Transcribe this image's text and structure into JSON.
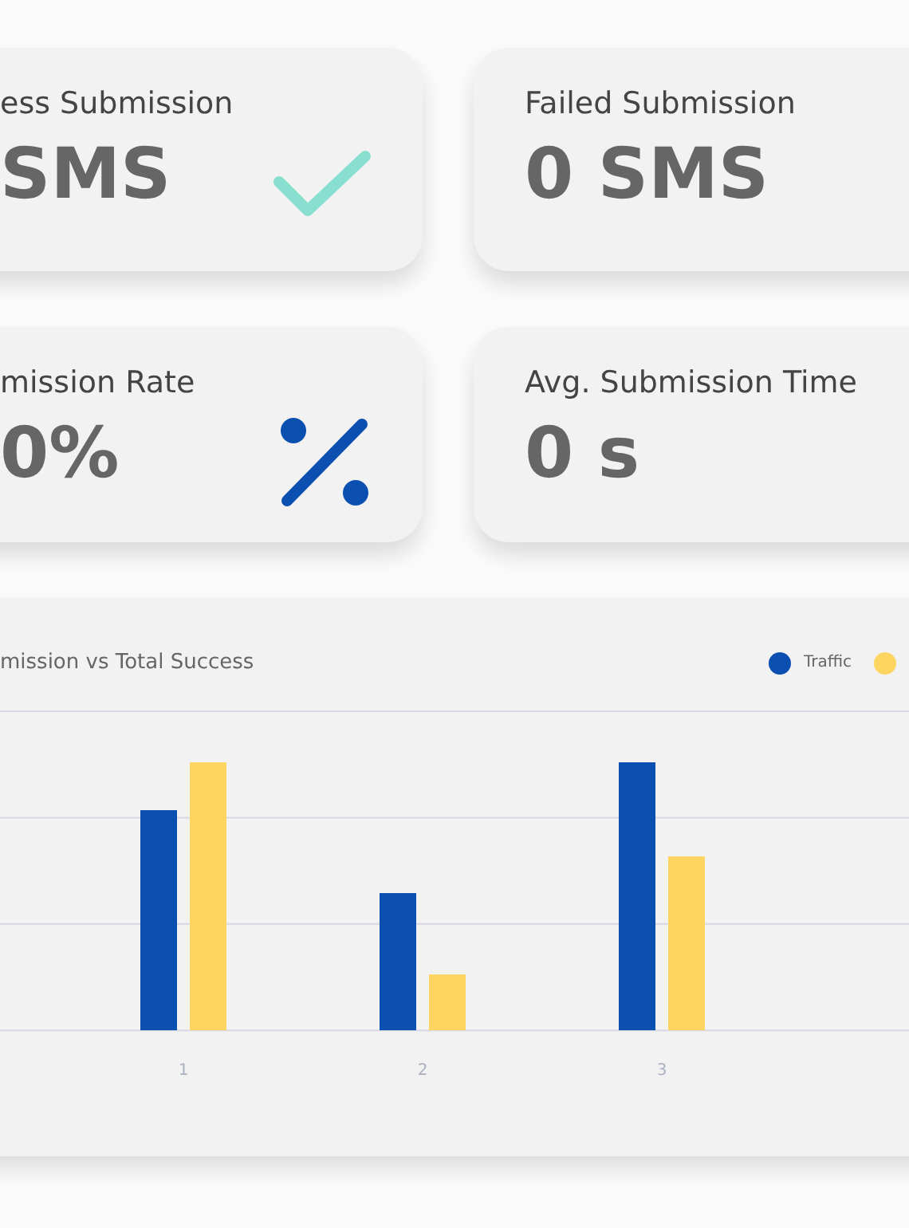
{
  "cards": [
    {
      "label": "ess Submission",
      "value": "SMS",
      "kind": "check"
    },
    {
      "label": "Failed Submission",
      "value": "0 SMS",
      "kind": "plain"
    },
    {
      "label": "mission Rate",
      "value": "0%",
      "kind": "percent"
    },
    {
      "label": "Avg. Submission Time",
      "value": "0 s",
      "kind": "plain"
    }
  ],
  "chart": {
    "title": "mission vs Total Success",
    "legend": [
      {
        "label": "Traffic",
        "color": "#0b50b0"
      },
      {
        "color": "#ffd561"
      }
    ],
    "x_labels": [
      "1",
      "2",
      "3"
    ]
  }
}
